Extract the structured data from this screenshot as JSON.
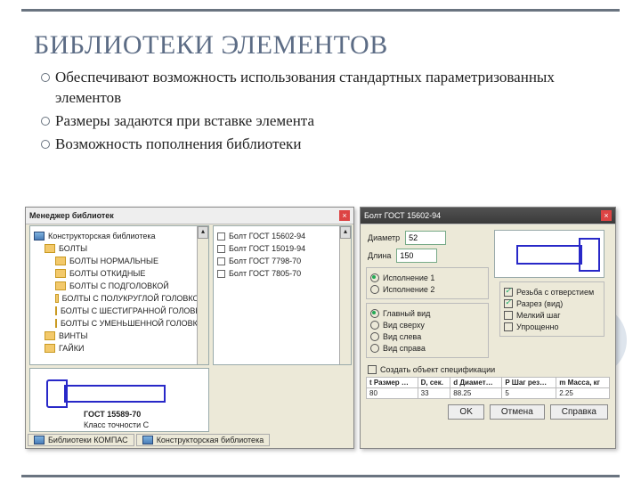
{
  "slide": {
    "title": "БИБЛИОТЕКИ ЭЛЕМЕНТОВ",
    "bullets": [
      "Обеспечивают возможность использования стандартных параметризованных элементов",
      "Размеры задаются  при вставке элемента",
      "Возможность пополнения библиотеки"
    ]
  },
  "manager": {
    "title": "Менеджер библиотек",
    "root": "Конструкторская библиотека",
    "cat": "БОЛТЫ",
    "nodes": [
      "БОЛТЫ НОРМАЛЬНЫЕ",
      "БОЛТЫ ОТКИДНЫЕ",
      "БОЛТЫ С ПОДГОЛОВКОЙ",
      "БОЛТЫ С ПОЛУКРУГЛОЙ ГОЛОВКОЙ",
      "БОЛТЫ С ШЕСТИГРАННОЙ ГОЛОВКОЙ",
      "БОЛТЫ С УМЕНЬШЕННОЙ ГОЛОВКОЙ"
    ],
    "other": [
      "ВИНТЫ",
      "ГАЙКИ"
    ],
    "items": [
      "Болт ГОСТ 15602-94",
      "Болт ГОСТ 15019-94",
      "Болт ГОСТ 7798-70",
      "Болт ГОСТ 7805-70"
    ],
    "preview_caption": "ГОСТ 15589-70",
    "preview_sub": "Класс точности С",
    "tabs": [
      "Библиотеки КОМПАС",
      "Конструкторская библиотека"
    ]
  },
  "dialog": {
    "title": "Болт ГОСТ 15602-94",
    "diameter_label": "Диаметр",
    "diameter_value": "52",
    "length_label": "Длина",
    "length_value": "150",
    "exec": [
      "Исполнение 1",
      "Исполнение 2"
    ],
    "view": [
      "Главный вид",
      "Вид сверху",
      "Вид слева",
      "Вид справа"
    ],
    "opts": [
      "Резьба с отверстием",
      "Разрез (вид)",
      "Мелкий шаг",
      "Упрощенно"
    ],
    "spec_check": "Создать объект спецификации",
    "table": {
      "headers": [
        "t Размер …",
        "D, сек.",
        "d Диамет…",
        "P Шаг рез…",
        "m Масса, кг"
      ],
      "row": [
        "80",
        "33",
        "88.25",
        "5",
        "2.25"
      ]
    },
    "ok": "OK",
    "cancel": "Отмена",
    "help": "Справка"
  }
}
